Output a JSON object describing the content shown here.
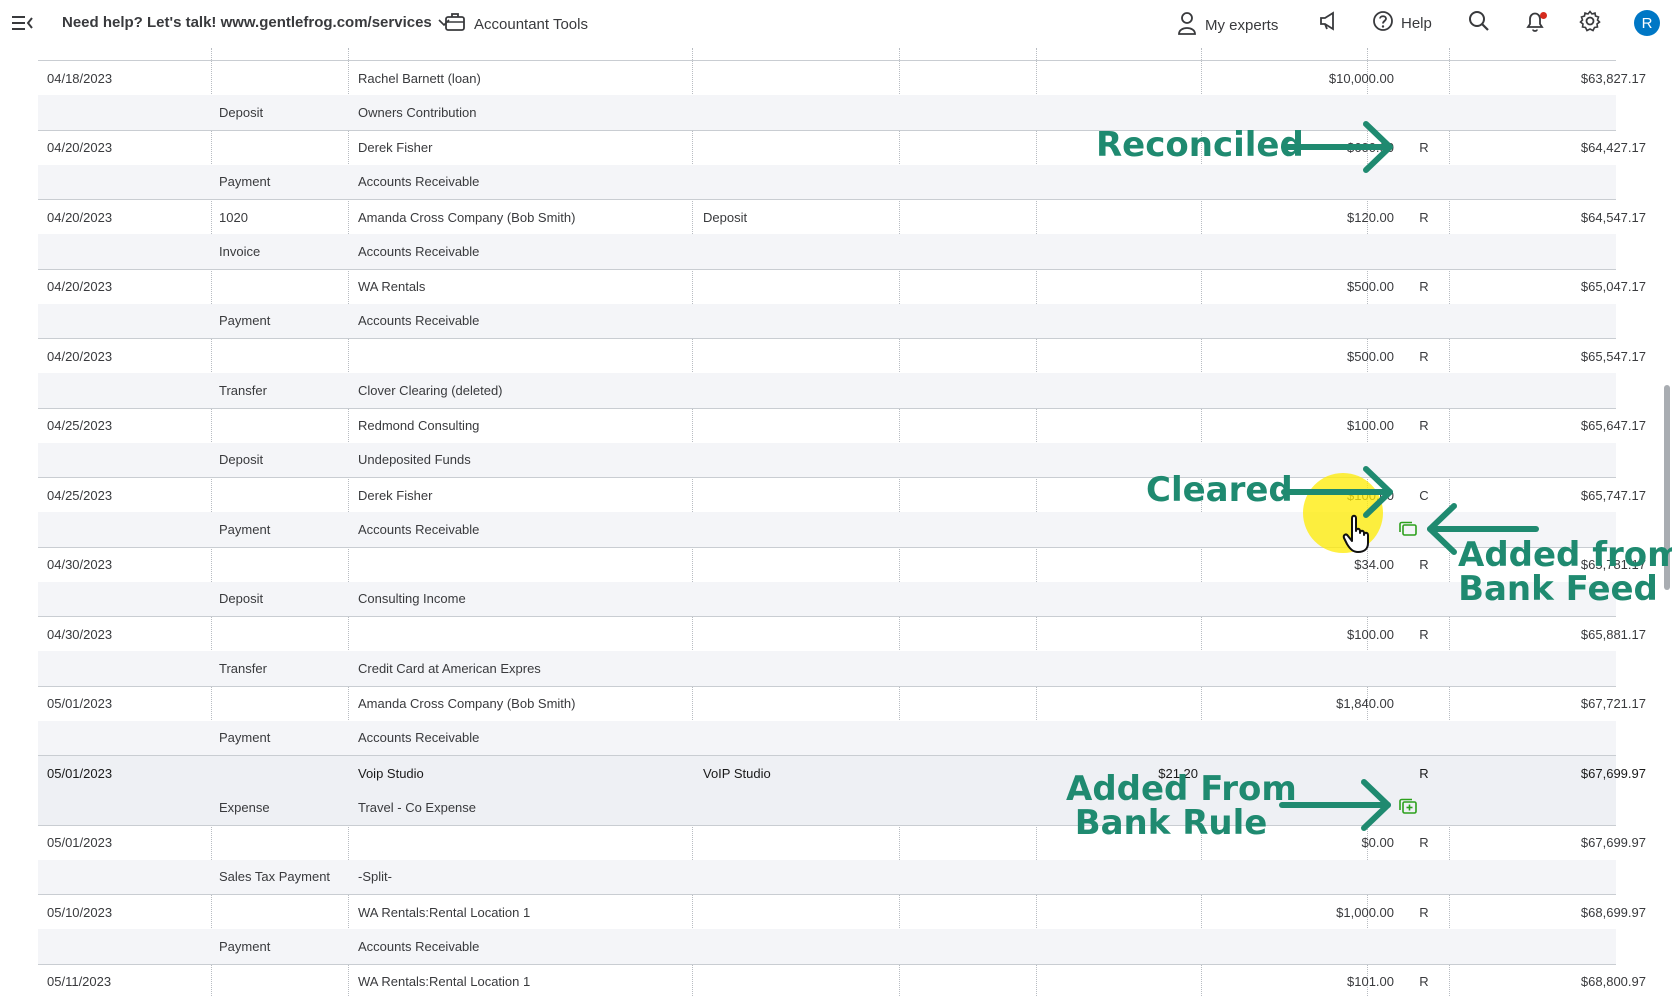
{
  "topbar": {
    "help_text": "Need help? Let's talk! www.gentlefrog.com/services",
    "accountant_tools": "Accountant Tools",
    "my_experts": "My experts",
    "help": "Help",
    "avatar_initial": "R"
  },
  "rows": [
    {
      "date": "04/18/2023",
      "ref": "",
      "payee": "Rachel Barnett (loan)",
      "memo": "",
      "payment": "",
      "deposit": "$10,000.00",
      "status": "",
      "balance": "$63,827.17",
      "type": "Deposit",
      "account": "Owners Contribution"
    },
    {
      "date": "04/20/2023",
      "ref": "",
      "payee": "Derek Fisher",
      "memo": "",
      "payment": "",
      "deposit": "$600.00",
      "status": "R",
      "balance": "$64,427.17",
      "type": "Payment",
      "account": "Accounts Receivable"
    },
    {
      "date": "04/20/2023",
      "ref": "1020",
      "payee": "Amanda Cross Company (Bob Smith)",
      "memo": "Deposit",
      "payment": "",
      "deposit": "$120.00",
      "status": "R",
      "balance": "$64,547.17",
      "type": "Invoice",
      "account": "Accounts Receivable"
    },
    {
      "date": "04/20/2023",
      "ref": "",
      "payee": "WA Rentals",
      "memo": "",
      "payment": "",
      "deposit": "$500.00",
      "status": "R",
      "balance": "$65,047.17",
      "type": "Payment",
      "account": "Accounts Receivable"
    },
    {
      "date": "04/20/2023",
      "ref": "",
      "payee": "",
      "memo": "",
      "payment": "",
      "deposit": "$500.00",
      "status": "R",
      "balance": "$65,547.17",
      "type": "Transfer",
      "account": "Clover Clearing (deleted)"
    },
    {
      "date": "04/25/2023",
      "ref": "",
      "payee": "Redmond Consulting",
      "memo": "",
      "payment": "",
      "deposit": "$100.00",
      "status": "R",
      "balance": "$65,647.17",
      "type": "Deposit",
      "account": "Undeposited Funds"
    },
    {
      "date": "04/25/2023",
      "ref": "",
      "payee": "Derek Fisher",
      "memo": "",
      "payment": "",
      "deposit": "$100.00",
      "status": "C",
      "balance": "$65,747.17",
      "type": "Payment",
      "account": "Accounts Receivable"
    },
    {
      "date": "04/30/2023",
      "ref": "",
      "payee": "",
      "memo": "",
      "payment": "",
      "deposit": "$34.00",
      "status": "R",
      "balance": "$65,781.17",
      "type": "Deposit",
      "account": "Consulting Income"
    },
    {
      "date": "04/30/2023",
      "ref": "",
      "payee": "",
      "memo": "",
      "payment": "",
      "deposit": "$100.00",
      "status": "R",
      "balance": "$65,881.17",
      "type": "Transfer",
      "account": "Credit Card at American Expres"
    },
    {
      "date": "05/01/2023",
      "ref": "",
      "payee": "Amanda Cross Company (Bob Smith)",
      "memo": "",
      "payment": "",
      "deposit": "$1,840.00",
      "status": "",
      "balance": "$67,721.17",
      "type": "Payment",
      "account": "Accounts Receivable"
    },
    {
      "date": "05/01/2023",
      "ref": "",
      "payee": "Voip Studio",
      "memo": "VoIP Studio",
      "payment": "$21.20",
      "deposit": "",
      "status": "R",
      "balance": "$67,699.97",
      "type": "Expense",
      "account": "Travel - Co Expense"
    },
    {
      "date": "05/01/2023",
      "ref": "",
      "payee": "",
      "memo": "",
      "payment": "",
      "deposit": "$0.00",
      "status": "R",
      "balance": "$67,699.97",
      "type": "Sales Tax Payment",
      "account": "-Split-"
    },
    {
      "date": "05/10/2023",
      "ref": "",
      "payee": "WA Rentals:Rental Location 1",
      "memo": "",
      "payment": "",
      "deposit": "$1,000.00",
      "status": "R",
      "balance": "$68,699.97",
      "type": "Payment",
      "account": "Accounts Receivable"
    },
    {
      "date": "05/11/2023",
      "ref": "",
      "payee": "WA Rentals:Rental Location 1",
      "memo": "",
      "payment": "",
      "deposit": "$101.00",
      "status": "R",
      "balance": "$68,800.97",
      "type": "",
      "account": ""
    }
  ],
  "annotations": {
    "reconciled": "Reconciled",
    "cleared": "Cleared",
    "bank_feed_1": "Added from",
    "bank_feed_2": "Bank Feed",
    "bank_rule_1": "Added From",
    "bank_rule_2": "Bank Rule"
  },
  "colors": {
    "annotation": "#1f8a70",
    "bank_icon": "#2ca01c",
    "highlight": "#ffeb00",
    "avatar": "#0077c5"
  },
  "icons": {
    "menu": "menu-collapse-icon",
    "briefcase": "briefcase-icon",
    "experts": "person-icon",
    "announce": "megaphone-icon",
    "help": "question-circle-icon",
    "search": "search-icon",
    "notifications": "bell-icon",
    "settings": "gear-icon"
  }
}
